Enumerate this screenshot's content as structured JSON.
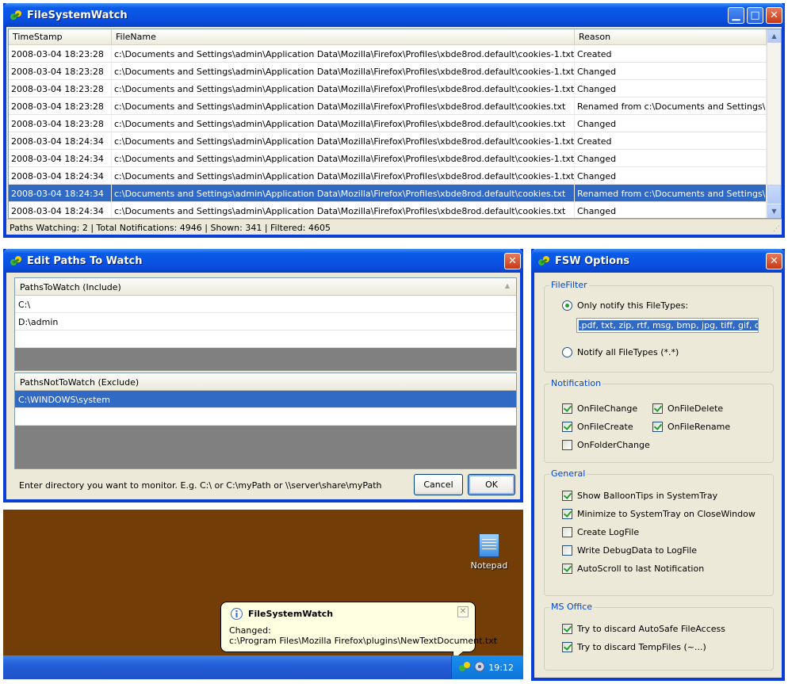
{
  "main_window": {
    "title": "FileSystemWatch",
    "columns": [
      "TimeStamp",
      "FileName",
      "Reason"
    ],
    "rows": [
      {
        "time": "2008-03-04 18:23:28",
        "file": "c:\\Documents and Settings\\admin\\Application Data\\Mozilla\\Firefox\\Profiles\\xbde8rod.default\\cookies-1.txt",
        "reason": "Created"
      },
      {
        "time": "2008-03-04 18:23:28",
        "file": "c:\\Documents and Settings\\admin\\Application Data\\Mozilla\\Firefox\\Profiles\\xbde8rod.default\\cookies-1.txt",
        "reason": "Changed"
      },
      {
        "time": "2008-03-04 18:23:28",
        "file": "c:\\Documents and Settings\\admin\\Application Data\\Mozilla\\Firefox\\Profiles\\xbde8rod.default\\cookies-1.txt",
        "reason": "Changed"
      },
      {
        "time": "2008-03-04 18:23:28",
        "file": "c:\\Documents and Settings\\admin\\Application Data\\Mozilla\\Firefox\\Profiles\\xbde8rod.default\\cookies.txt",
        "reason": "Renamed from c:\\Documents and Settings\\ad..."
      },
      {
        "time": "2008-03-04 18:23:28",
        "file": "c:\\Documents and Settings\\admin\\Application Data\\Mozilla\\Firefox\\Profiles\\xbde8rod.default\\cookies.txt",
        "reason": "Changed"
      },
      {
        "time": "2008-03-04 18:24:34",
        "file": "c:\\Documents and Settings\\admin\\Application Data\\Mozilla\\Firefox\\Profiles\\xbde8rod.default\\cookies-1.txt",
        "reason": "Created"
      },
      {
        "time": "2008-03-04 18:24:34",
        "file": "c:\\Documents and Settings\\admin\\Application Data\\Mozilla\\Firefox\\Profiles\\xbde8rod.default\\cookies-1.txt",
        "reason": "Changed"
      },
      {
        "time": "2008-03-04 18:24:34",
        "file": "c:\\Documents and Settings\\admin\\Application Data\\Mozilla\\Firefox\\Profiles\\xbde8rod.default\\cookies-1.txt",
        "reason": "Changed"
      },
      {
        "time": "2008-03-04 18:24:34",
        "file": "c:\\Documents and Settings\\admin\\Application Data\\Mozilla\\Firefox\\Profiles\\xbde8rod.default\\cookies.txt",
        "reason": "Renamed from c:\\Documents and Settings\\ad..."
      },
      {
        "time": "2008-03-04 18:24:34",
        "file": "c:\\Documents and Settings\\admin\\Application Data\\Mozilla\\Firefox\\Profiles\\xbde8rod.default\\cookies.txt",
        "reason": "Changed"
      }
    ],
    "selected_row_index": 8,
    "status": "Paths Watching: 2 | Total Notifications: 4946 | Shown: 341 | Filtered: 4605"
  },
  "edit_paths": {
    "title": "Edit Paths To Watch",
    "include_header": "PathsToWatch (Include)",
    "include_rows": [
      "C:\\",
      "D:\\admin",
      ""
    ],
    "exclude_header": "PathsNotToWatch (Exclude)",
    "exclude_rows": [
      "C:\\WINDOWS\\system",
      ""
    ],
    "hint": "Enter directory you want to monitor. E.g. C:\\ or C:\\myPath or \\\\server\\share\\myPath",
    "cancel_label": "Cancel",
    "ok_label": "OK"
  },
  "desktop": {
    "notepad_label": "Notepad",
    "clock": "19:12",
    "balloon": {
      "title": "FileSystemWatch",
      "line1": "Changed:",
      "line2": "c:\\Program Files\\Mozilla Firefox\\plugins\\NewTextDocument.txt"
    }
  },
  "options": {
    "title": "FSW Options",
    "filefilter": {
      "title": "FileFilter",
      "only_label": "Only notify this FileTypes:",
      "filetypes_value": ".pdf, txt, zip, rtf, msg, bmp, jpg, tiff, gif, c, cpp, h",
      "all_label": "Notify all FileTypes (*.*)",
      "selected": "only"
    },
    "notification": {
      "title": "Notification",
      "items": [
        {
          "label": "OnFileChange",
          "checked": true
        },
        {
          "label": "OnFileDelete",
          "checked": true
        },
        {
          "label": "OnFileCreate",
          "checked": true
        },
        {
          "label": "OnFileRename",
          "checked": true
        },
        {
          "label": "OnFolderChange",
          "checked": false
        }
      ]
    },
    "general": {
      "title": "General",
      "items": [
        {
          "label": "Show BalloonTips in SystemTray",
          "checked": true
        },
        {
          "label": "Minimize to SystemTray on CloseWindow",
          "checked": true
        },
        {
          "label": "Create LogFile",
          "checked": false
        },
        {
          "label": "Write DebugData to LogFile",
          "checked": false
        },
        {
          "label": "AutoScroll to last Notification",
          "checked": true
        }
      ]
    },
    "msoffice": {
      "title": "MS Office",
      "items": [
        {
          "label": "Try to discard AutoSafe FileAccess",
          "checked": true
        },
        {
          "label": "Try to discard TempFiles (~...)",
          "checked": true
        }
      ]
    }
  },
  "colors": {
    "title_blue": "#0a4fe0",
    "selection": "#316ac5",
    "window_face": "#ece9d8",
    "desktop_brown": "#723d07"
  }
}
